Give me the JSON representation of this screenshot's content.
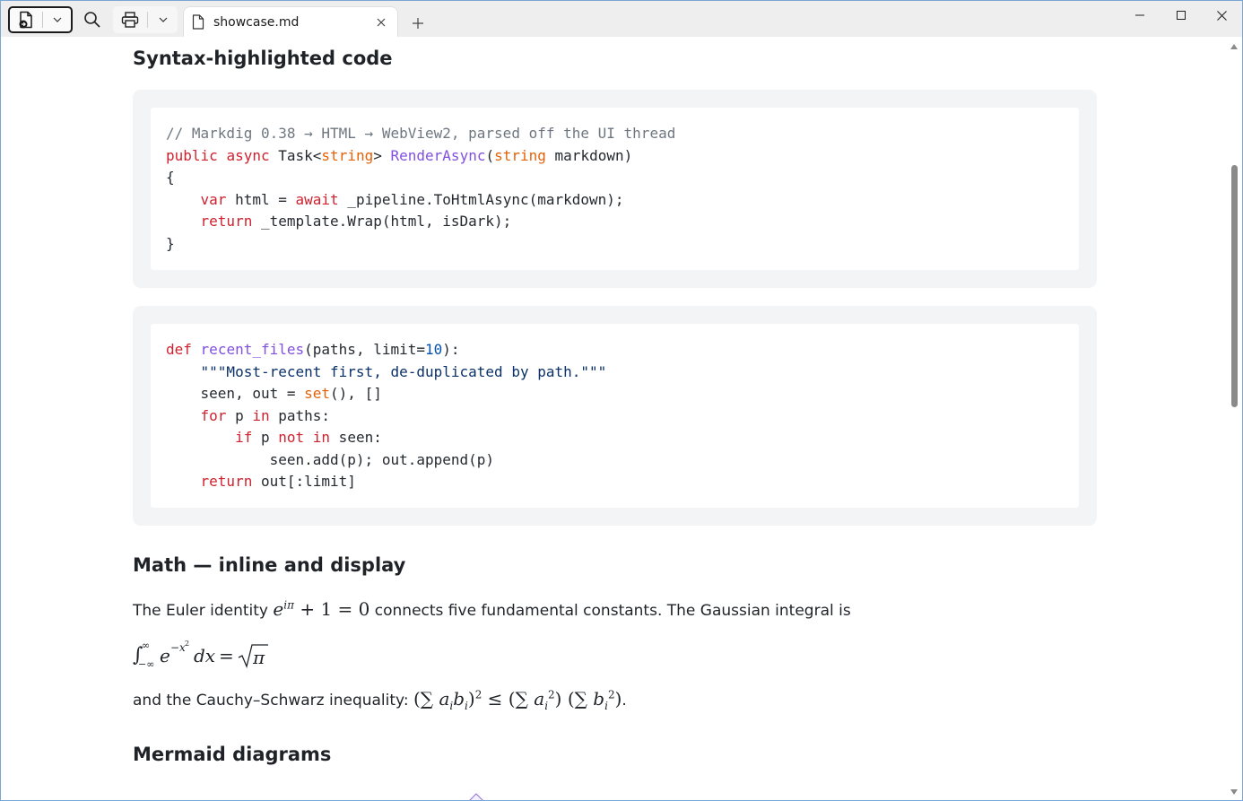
{
  "tab": {
    "title": "showcase.md"
  },
  "sections": {
    "code_heading": "Syntax-highlighted code",
    "math_heading": "Math — inline and display",
    "mermaid_heading": "Mermaid diagrams"
  },
  "code1": {
    "l1": "// Markdig 0.38 → HTML → WebView2, parsed off the UI thread",
    "l2_kw1": "public",
    "l2_kw2": "async",
    "l2_t": "Task<",
    "l2_ty": "string",
    "l2_gt": ">",
    "l2_fn": "RenderAsync",
    "l2_p1": "(",
    "l2_ty2": "string",
    "l2_rest": " markdown)",
    "l3": "{",
    "l4_kw": "var",
    "l4_a": " html = ",
    "l4_kw2": "await",
    "l4_b": " _pipeline.ToHtmlAsync(markdown);",
    "l5_kw": "return",
    "l5_b": " _template.Wrap(html, isDark);",
    "l6": "}"
  },
  "code2": {
    "l1_kw": "def",
    "l1_fn": "recent_files",
    "l1_a": "(paths, limit=",
    "l1_num": "10",
    "l1_b": "):",
    "l2_str": "\"\"\"Most-recent first, de-duplicated by path.\"\"\"",
    "l3_a": "seen, out = ",
    "l3_bi": "set",
    "l3_b": "(), []",
    "l4_kw": "for",
    "l4_a": " p ",
    "l4_kw2": "in",
    "l4_b": " paths:",
    "l5_kw": "if",
    "l5_a": " p ",
    "l5_kw2": "not",
    "l5_kw3": "in",
    "l5_b": " seen:",
    "l6": "seen.add(p); out.append(p)",
    "l7_kw": "return",
    "l7_b": " out[:limit]"
  },
  "math": {
    "p1_before": "The Euler identity ",
    "p1_after": " connects five fundamental constants. The Gaussian integral is",
    "p3_before": "and the Cauchy–Schwarz inequality: ",
    "p3_after": "."
  },
  "icons": {
    "app": "app-open-icon",
    "search": "search-icon",
    "print": "printer-icon",
    "doc": "document-icon",
    "close": "close-icon",
    "new_tab": "plus-icon",
    "minimize": "minimize-icon",
    "maximize": "maximize-icon",
    "window_close": "window-close-icon"
  }
}
